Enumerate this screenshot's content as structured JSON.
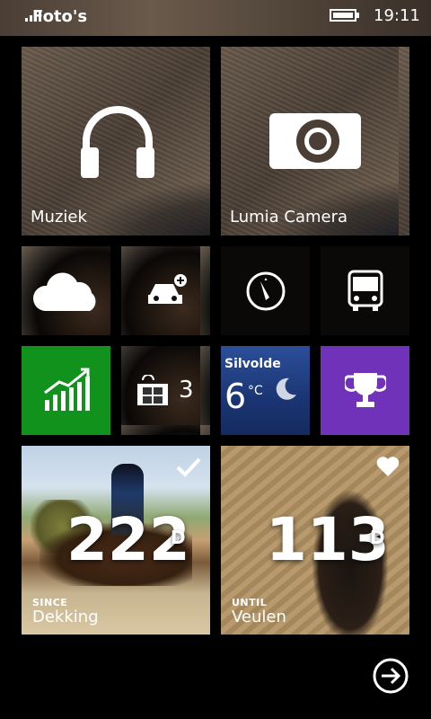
{
  "status_bar": {
    "app_name": "Foto's",
    "time": "19:11"
  },
  "tiles": {
    "music": {
      "label": "Muziek"
    },
    "camera": {
      "label": "Lumia Camera"
    },
    "store": {
      "count": "3"
    },
    "weather": {
      "city": "Silvolde",
      "temperature": "6",
      "unit": "°C"
    },
    "countdown_1": {
      "prefix": "SINCE",
      "number": "222",
      "unit": "D",
      "label": "Dekking"
    },
    "countdown_2": {
      "prefix": "UNTIL",
      "number": "113",
      "unit": "D",
      "label": "Veulen"
    }
  },
  "colors": {
    "finance_tile": "#10921c",
    "games_tile": "#6f32b8",
    "weather_tile": "#1f3f8a"
  },
  "icons": [
    "signal-icon",
    "battery-icon",
    "headphones-icon",
    "camera-icon",
    "cloud-icon",
    "car-add-icon",
    "compass-icon",
    "bus-icon",
    "stock-chart-icon",
    "store-icon",
    "moon-icon",
    "trophy-icon",
    "check-icon",
    "heart-icon",
    "arrow-right-circle-icon"
  ]
}
